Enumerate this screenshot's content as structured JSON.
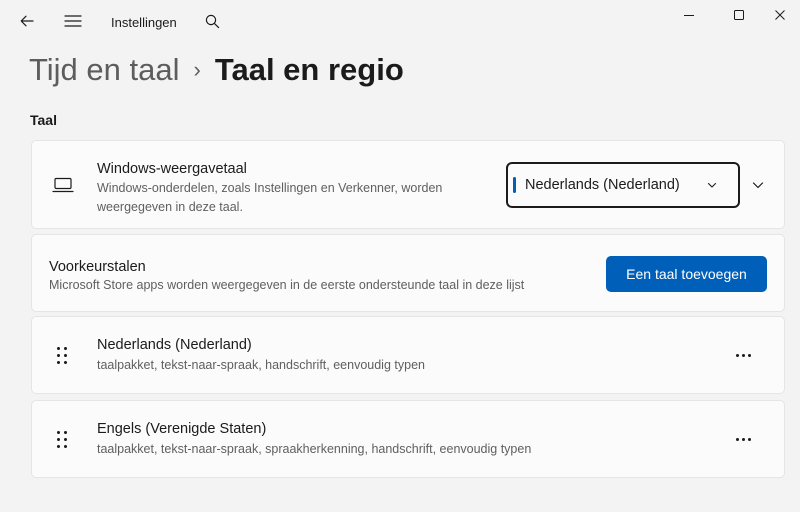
{
  "titlebar": {
    "app_title": "Instellingen"
  },
  "icons": {
    "back": "back-arrow-icon",
    "menu": "hamburger-menu-icon",
    "search": "search-icon",
    "minimize": "minimize-icon",
    "maximize": "maximize-icon",
    "close": "close-icon"
  },
  "breadcrumb": {
    "parent": "Tijd en taal",
    "separator": "›",
    "current": "Taal en regio"
  },
  "section": {
    "title": "Taal"
  },
  "display_language": {
    "title": "Windows-weergavetaal",
    "description": "Windows-onderdelen, zoals Instellingen en Verkenner, worden weergegeven in deze taal.",
    "selected": "Nederlands (Nederland)"
  },
  "preferred_languages": {
    "title": "Voorkeurstalen",
    "description": "Microsoft Store apps worden weergegeven in de eerste ondersteunde taal in deze lijst",
    "add_button": "Een taal toevoegen",
    "items": [
      {
        "name": "Nederlands (Nederland)",
        "features": "taalpakket, tekst-naar-spraak, handschrift, eenvoudig typen"
      },
      {
        "name": "Engels (Verenigde Staten)",
        "features": "taalpakket, tekst-naar-spraak, spraakherkenning, handschrift, eenvoudig typen"
      }
    ]
  },
  "colors": {
    "accent": "#005fb8",
    "background": "#f3f3f3",
    "card": "#fbfbfb"
  }
}
